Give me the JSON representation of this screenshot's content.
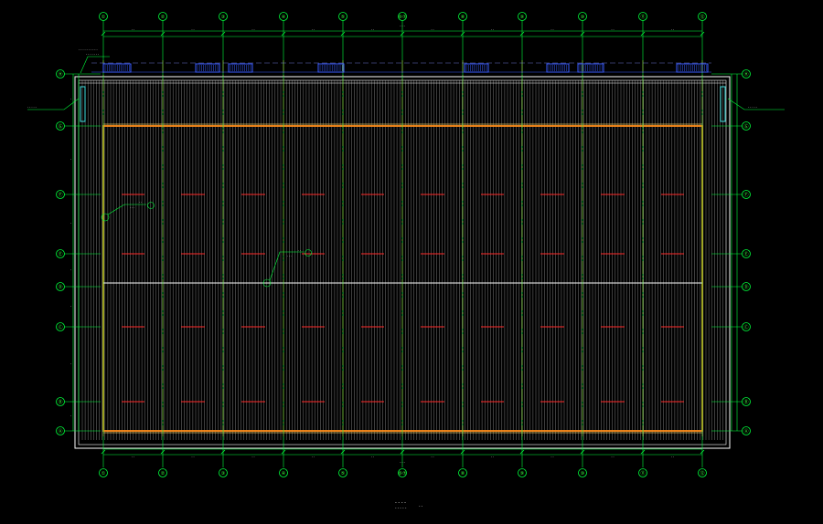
{
  "drawing": {
    "axes_x": [
      "①",
      "②",
      "③",
      "④",
      "⑤",
      "⑥⑦",
      "⑧",
      "⑨",
      "⑩",
      "⑪",
      "⑫"
    ],
    "axes_y": [
      "Ⓗ",
      "Ⓖ",
      "Ⓕ",
      "Ⓔ",
      "Ⓓ",
      "Ⓒ",
      "Ⓑ",
      "Ⓐ"
    ],
    "dims_top": [
      "- -",
      "- -",
      "- -",
      "- -",
      "- -",
      "- -",
      "- -",
      "- -",
      "- -",
      "- -"
    ],
    "dims_bottom": [
      "- -",
      "- -",
      "- -",
      "- -",
      "- -",
      "- -",
      "- -",
      "- -",
      "- -",
      "- -"
    ],
    "dim_total": "- - -",
    "dims_left": [
      "-",
      "-",
      "-",
      "-",
      "-",
      "-",
      "-"
    ],
    "callouts": {
      "top_note_1": "- - - - - - - - - -",
      "top_note_2": "- - - - - - -",
      "left_note": "- - - - -",
      "right_note": "- - - - -",
      "inner_1_top": "- -",
      "inner_1_bottom": "- - -",
      "inner_2_top": "- -",
      "inner_2_bottom": "- - -"
    },
    "title": "- - - -",
    "subtitle": "- - - - -",
    "scale": "- -"
  },
  "colors": {
    "grid": "#00ff3c",
    "beam": "#ff2a2a",
    "edge": "#ff8c1a",
    "ribs": "#ffffff",
    "outline": "#ffffff",
    "vent": "#3a5cff",
    "bg": "#000000"
  }
}
